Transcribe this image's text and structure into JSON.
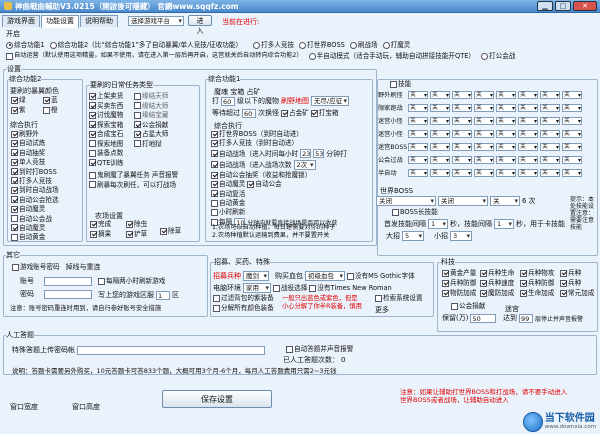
{
  "window": {
    "title": "神曲戰曲輔助V3.0215（開啟後可隱藏） 官網www.sqqfz.com",
    "min": "▁",
    "max": "□",
    "close": "✕"
  },
  "tabs": [
    "游戏界面",
    "功能设置",
    "说明帮助"
  ],
  "topbar": {
    "game_select": "选择游戏平台",
    "enter_btn": "进入",
    "status": "当前在进行:"
  },
  "start": {
    "title": "开启",
    "radio1": "综合功能1",
    "radio2": "综合功能2（比“综合功能1”多了自动暴翼/单人竞技/征收功能）",
    "auto_run": "自动运营（默认使用这项精靈，如果不使用，请在进入第一层后再开启，这宫就关后自动转向综合功能2）",
    "r3": "打多人竞技",
    "r4": "打世界BOSS",
    "r5": "刷战场",
    "r6": "打魔灵",
    "r7": "半自动模式（适合手动玩，辅助自动拼接技能开QTE）",
    "r8": "打公会战"
  },
  "settings": {
    "title": "设置",
    "c2": {
      "title": "综合功能2",
      "sub1": "要刷的暴翼颜色",
      "colors": [
        "绿",
        "蓝",
        "紫",
        "橙"
      ],
      "sub2": "综合执行",
      "items": [
        "刷野外",
        "自动试炼",
        "自动抽奖",
        "单人竞技",
        "到时打BOSS",
        "打多人竞技",
        "到时自动战场",
        "自动公会抢选",
        "自动魔灵",
        "自动公会战",
        "自动魔灵",
        "自动黄金"
      ]
    },
    "tasks": {
      "title": "要刷的日常任务类型",
      "left": [
        "上架卖货",
        "买卖东西",
        "讨伐魔物",
        "探索宝箱",
        "合成宝石",
        "探索地图",
        "装备点数",
        "QTE训练"
      ],
      "right": [
        "缘结天师",
        "缘结大师",
        "缘结宝藏",
        "公会捐献",
        "占星大师",
        "打地狱"
      ],
      "extra1": "鬼刷魔了暴翼任务 声音报警",
      "extra2": "刷暴每次刷任，可以打战场",
      "tongtian": "农场设置",
      "farm": [
        "完成",
        "除虫",
        "摘果",
        "铲草"
      ],
      "farm_side": "除草"
    },
    "c1": {
      "title": "综合功能1",
      "line1": "魔魂  宝箱  占矿",
      "line2a": "打",
      "lvl": "60",
      "line2b": "级以下的魔物",
      "refresh": "刷野地图",
      "no_sign": "无尽/应征",
      "line3a": "等待超过",
      "wait": "60",
      "line3b": "次换怪",
      "occupy": "占金矿",
      "treasure": "打宝箱",
      "exec": "综合执行",
      "items": [
        "打世界BOSS（到时自动进）",
        "打多人竞技（到时自动进）",
        "自动战场（进入时间每小时",
        "自动战场（进入战场次数",
        "自动公会抽奖（收益和抢魔锁）",
        "自动魔灵",
        "自动复活",
        "自动黄金",
        "刷新战场",
        "每隔一小时刷新一次"
      ],
      "time1": "23",
      "time2": "53",
      "time_unit": "分钟打",
      "times": "2次",
      "auto_fight": "自动公会",
      "revive_note": "小时刷新",
      "every": "每隔",
      "every_val": "10",
      "every_unit": "分钟内就要直接战场是否可以收获",
      "note1": "1.农场可以自动种植，每日建需要对你的种子",
      "note2": "2.农场种植默认运输到费果，并不要置开关"
    }
  },
  "boss_panel": {
    "skill_label": "技能",
    "rows": [
      {
        "name": "野外刷怪",
        "opts": [
          "关",
          "关",
          "关",
          "关",
          "关",
          "关",
          "关",
          "关"
        ]
      },
      {
        "name": "限家跑战",
        "opts": [
          "关",
          "关",
          "关",
          "关",
          "关",
          "关",
          "关",
          "关"
        ]
      },
      {
        "name": "迷宫小怪",
        "opts": [
          "关",
          "关",
          "关",
          "关",
          "关",
          "关",
          "关",
          "关"
        ]
      },
      {
        "name": "迷宫小怪",
        "opts": [
          "关",
          "关",
          "关",
          "关",
          "关",
          "关",
          "关",
          "关"
        ]
      },
      {
        "name": "迷宫BOSS",
        "opts": [
          "关",
          "关",
          "关",
          "关",
          "关",
          "关",
          "关",
          "关"
        ]
      },
      {
        "name": "公会过战",
        "opts": [
          "关",
          "关",
          "关",
          "关",
          "关",
          "关",
          "关",
          "关"
        ]
      },
      {
        "name": "半自动",
        "opts": [
          "关",
          "关",
          "关",
          "关",
          "关",
          "关",
          "关",
          "关"
        ]
      }
    ],
    "world_boss": "世界BOSS",
    "wb_a": "关闭",
    "wb_b": "关闭",
    "wb_c": "关",
    "wb_d": "6",
    "wb_e": "次",
    "boss_skill": "BOSS长技能",
    "first_skill": "首发技能间隔",
    "fs_val": "1",
    "fs_unit": "秒，技能间隔",
    "fs2_val": "1",
    "fs2_unit": "秒，用于卡技能",
    "big": "大招",
    "big_val": "5",
    "small": "小招",
    "small_val": "3",
    "hint": "提示：本处技能设置注意：需要注意技能"
  },
  "other": {
    "title": "其它",
    "game_pw": "游戏账号密码",
    "auto_reconnect": "掉线与重连",
    "account_lbl": "账号",
    "pw_lbl": "密码",
    "hourly": "每隔两小时刷新游戏",
    "region": "写上您的游戏区服",
    "region_val": "1",
    "region_unit": "区",
    "note": "注意：账号密码重连时用到，请自行参好账号安全措施"
  },
  "magic": {
    "title": "招募、买药、特殊",
    "recruit": "招募兵种",
    "recruit_val": "魔剑",
    "buy_blood": "购买血包",
    "blood_val": "初级血包",
    "pet": "电脑环境",
    "pet_val": "家用",
    "skill_sel": "战役选择",
    "noMS": "没有MS Gothic字体",
    "skill_cb": "检索系统设置",
    "noTNR": "没有Times New Roman",
    "note_red1": "一般只出蓝色或紫色，但是",
    "note_red2": "小心分解了你半R装备，慎用",
    "decompose1": "过滤背包的紫装备",
    "decompose2": "分解所有颜色装备",
    "more": "更多"
  },
  "tech": {
    "title": "科技",
    "items": [
      [
        "黄金产量",
        "兵种生命",
        "兵种物攻",
        "兵种"
      ],
      [
        "兵种防御",
        "兵种速度",
        "兵种防御",
        "兵种"
      ],
      [
        "物防加成",
        "魔防加成",
        "生命加成",
        "常元加成"
      ]
    ],
    "guild": "公会捐献",
    "save_lbl": "保留(万)",
    "save_val": "50",
    "maze": "迷宫",
    "reach_lbl": "达到",
    "reach_val": "99",
    "reach_unit": "层停止并声音报警"
  },
  "human": {
    "title": "人工答题",
    "account_lbl": "特殊答题上传密码帐",
    "auto_answer": "自动答题并声音报警",
    "count_lbl": "已人工答题次数：",
    "count_val": "0",
    "desc": "说明：答题卡需要另外购买，10元答题卡可答833个题，大概可用3个月-6个月，每月人工答题费用只需2~3元钱"
  },
  "footer": {
    "save_btn": "保存设置",
    "win_w": "窗口宽度",
    "win_h": "窗口高度",
    "notice1": "注意：如果让辅助打世界BOSS和打战场，请不要手动进入",
    "notice2": "世界BOSS或者战场，让辅助自动进入"
  },
  "watermark": {
    "brand": "当下软件园",
    "url": "www.downxia.com"
  }
}
